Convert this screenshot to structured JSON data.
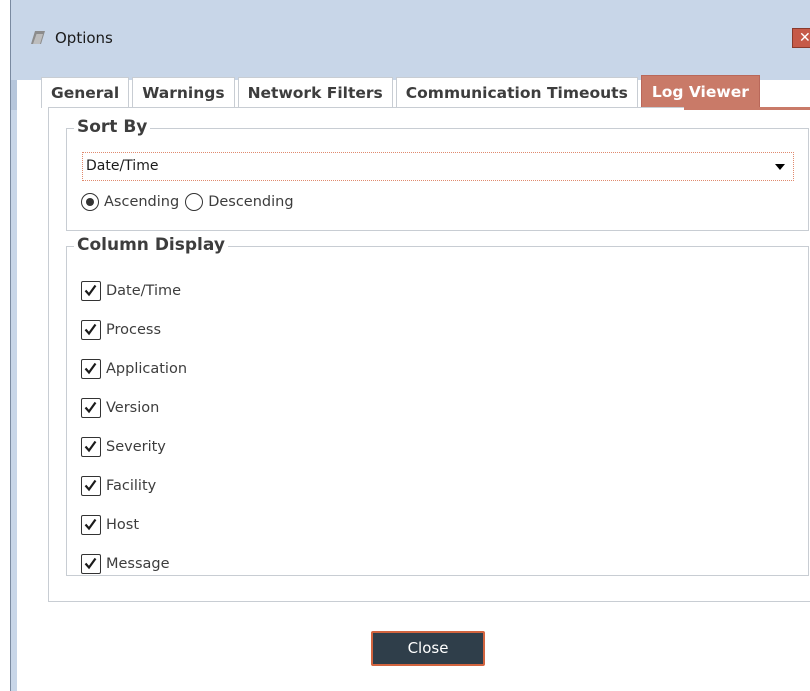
{
  "window": {
    "title": "Options",
    "close_glyph": "✕"
  },
  "tabs": [
    {
      "label": "General",
      "active": false
    },
    {
      "label": "Warnings",
      "active": false
    },
    {
      "label": "Network Filters",
      "active": false
    },
    {
      "label": "Communication Timeouts",
      "active": false
    },
    {
      "label": "Log Viewer",
      "active": true
    }
  ],
  "sort_by": {
    "legend": "Sort By",
    "selected": "Date/Time",
    "order_options": [
      {
        "label": "Ascending",
        "checked": true
      },
      {
        "label": "Descending",
        "checked": false
      }
    ]
  },
  "column_display": {
    "legend": "Column Display",
    "columns": [
      {
        "label": "Date/Time",
        "checked": true
      },
      {
        "label": "Process",
        "checked": true
      },
      {
        "label": "Application",
        "checked": true
      },
      {
        "label": "Version",
        "checked": true
      },
      {
        "label": "Severity",
        "checked": true
      },
      {
        "label": "Facility",
        "checked": true
      },
      {
        "label": "Host",
        "checked": true
      },
      {
        "label": "Message",
        "checked": true
      }
    ]
  },
  "footer": {
    "close_label": "Close"
  },
  "colors": {
    "accent": "#c97a68",
    "titlebar": "#c8d6e8",
    "button_bg": "#2f3e4a",
    "button_border": "#d2643f"
  },
  "icons": {
    "app": "app-icon",
    "close": "close-icon",
    "dropdown": "chevron-down-icon",
    "check": "check-icon"
  }
}
